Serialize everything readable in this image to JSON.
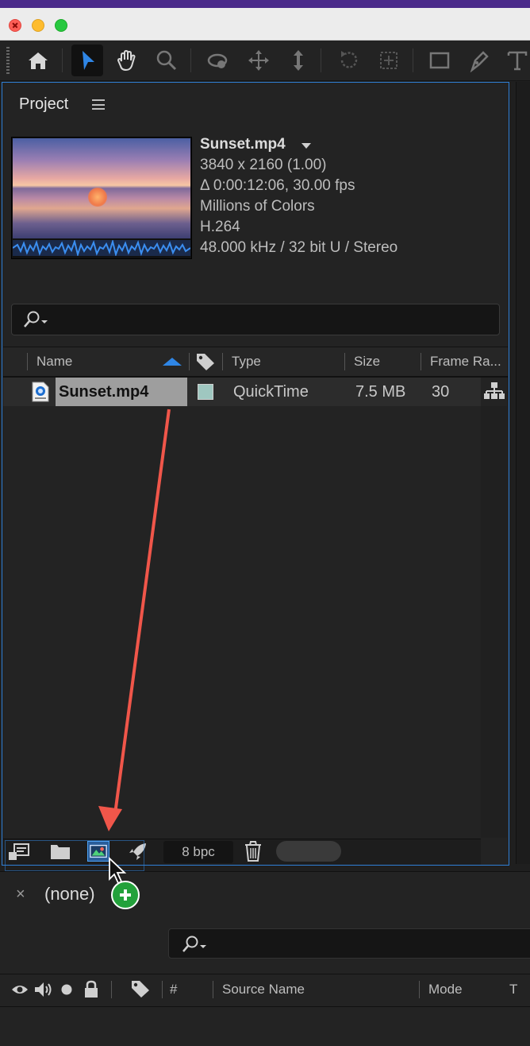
{
  "project": {
    "title": "Project",
    "footage": {
      "name": "Sunset.mp4",
      "resolution": "3840 x 2160 (1.00)",
      "duration": "Δ 0:00:12:06, 30.00 fps",
      "colors": "Millions of Colors",
      "codec": "H.264",
      "audio": "48.000 kHz / 32 bit U / Stereo"
    },
    "columns": {
      "name": "Name",
      "type": "Type",
      "size": "Size",
      "frame_rate": "Frame Ra..."
    },
    "items": [
      {
        "name": "Sunset.mp4",
        "type": "QuickTime",
        "size": "7.5 MB",
        "frame_rate": "30",
        "label_color": "#9fc7c0"
      }
    ],
    "bit_depth": "8 bpc"
  },
  "timeline": {
    "tab_label": "(none)",
    "close_label": "×",
    "columns": {
      "number": "#",
      "source_name": "Source Name",
      "mode": "Mode",
      "t": "T"
    }
  },
  "colors": {
    "accent": "#2f86e6",
    "annotation_arrow": "#f0564a",
    "add_badge": "#23a13b"
  }
}
